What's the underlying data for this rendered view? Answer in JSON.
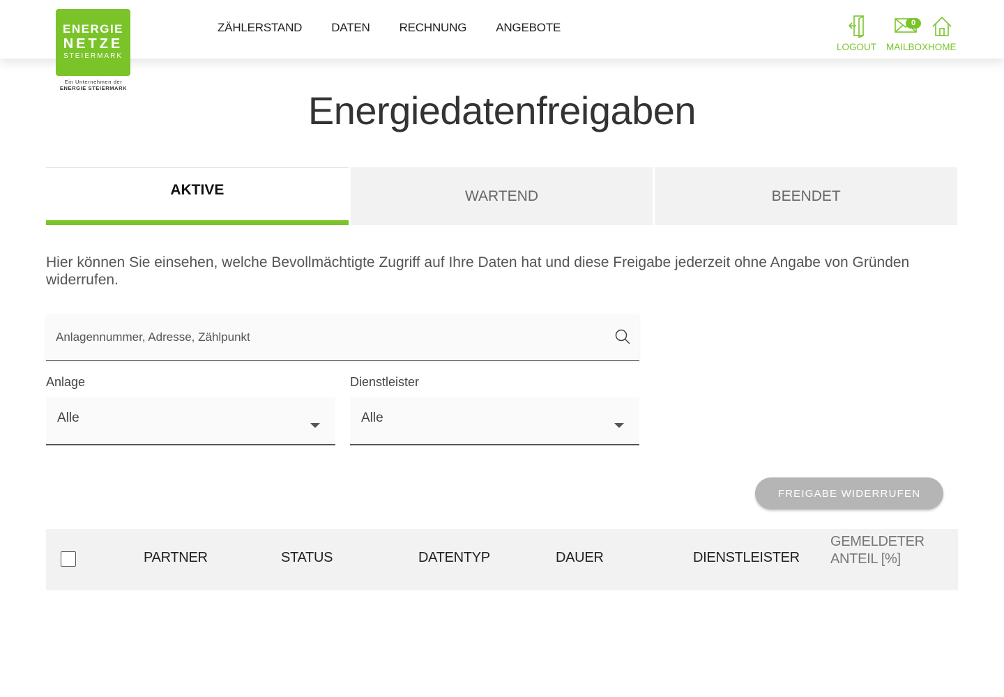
{
  "logo": {
    "line1": "ENERGIE",
    "line2": "NETZE",
    "line3": "STEIERMARK",
    "sub1": "Ein Unternehmen der",
    "sub2": "ENERGIE STEIERMARK"
  },
  "nav": {
    "items": [
      "ZÄHLERSTAND",
      "DATEN",
      "RECHNUNG",
      "ANGEBOTE"
    ]
  },
  "header_actions": {
    "logout": "LOGOUT",
    "mailbox": "MAILBOX",
    "mailbox_count": "0",
    "home": "HOME"
  },
  "colors": {
    "brand": "#7ac42a",
    "button_disabled": "#b5b5b5",
    "tab_inactive_bg": "#f2f2f2"
  },
  "page_title": "Energiedatenfreigaben",
  "tabs": [
    {
      "label": "AKTIVE",
      "active": true
    },
    {
      "label": "WARTEND",
      "active": false
    },
    {
      "label": "BEENDET",
      "active": false
    }
  ],
  "intro": "Hier können Sie einsehen, welche Bevollmächtigte Zugriff auf Ihre Daten hat und diese Freigabe jederzeit ohne Angabe von Gründen widerrufen.",
  "search": {
    "placeholder": "Anlagennummer, Adresse, Zählpunkt",
    "value": ""
  },
  "filters": {
    "anlage": {
      "label": "Anlage",
      "value": "Alle"
    },
    "dienstleister": {
      "label": "Dienstleister",
      "value": "Alle"
    }
  },
  "revoke_button": "FREIGABE WIDERRUFEN",
  "table": {
    "columns": [
      "PARTNER",
      "STATUS",
      "DATENTYP",
      "DAUER",
      "DIENSTLEISTER"
    ],
    "last_column": [
      "GEMELDETER",
      "ANTEIL [%]"
    ]
  }
}
